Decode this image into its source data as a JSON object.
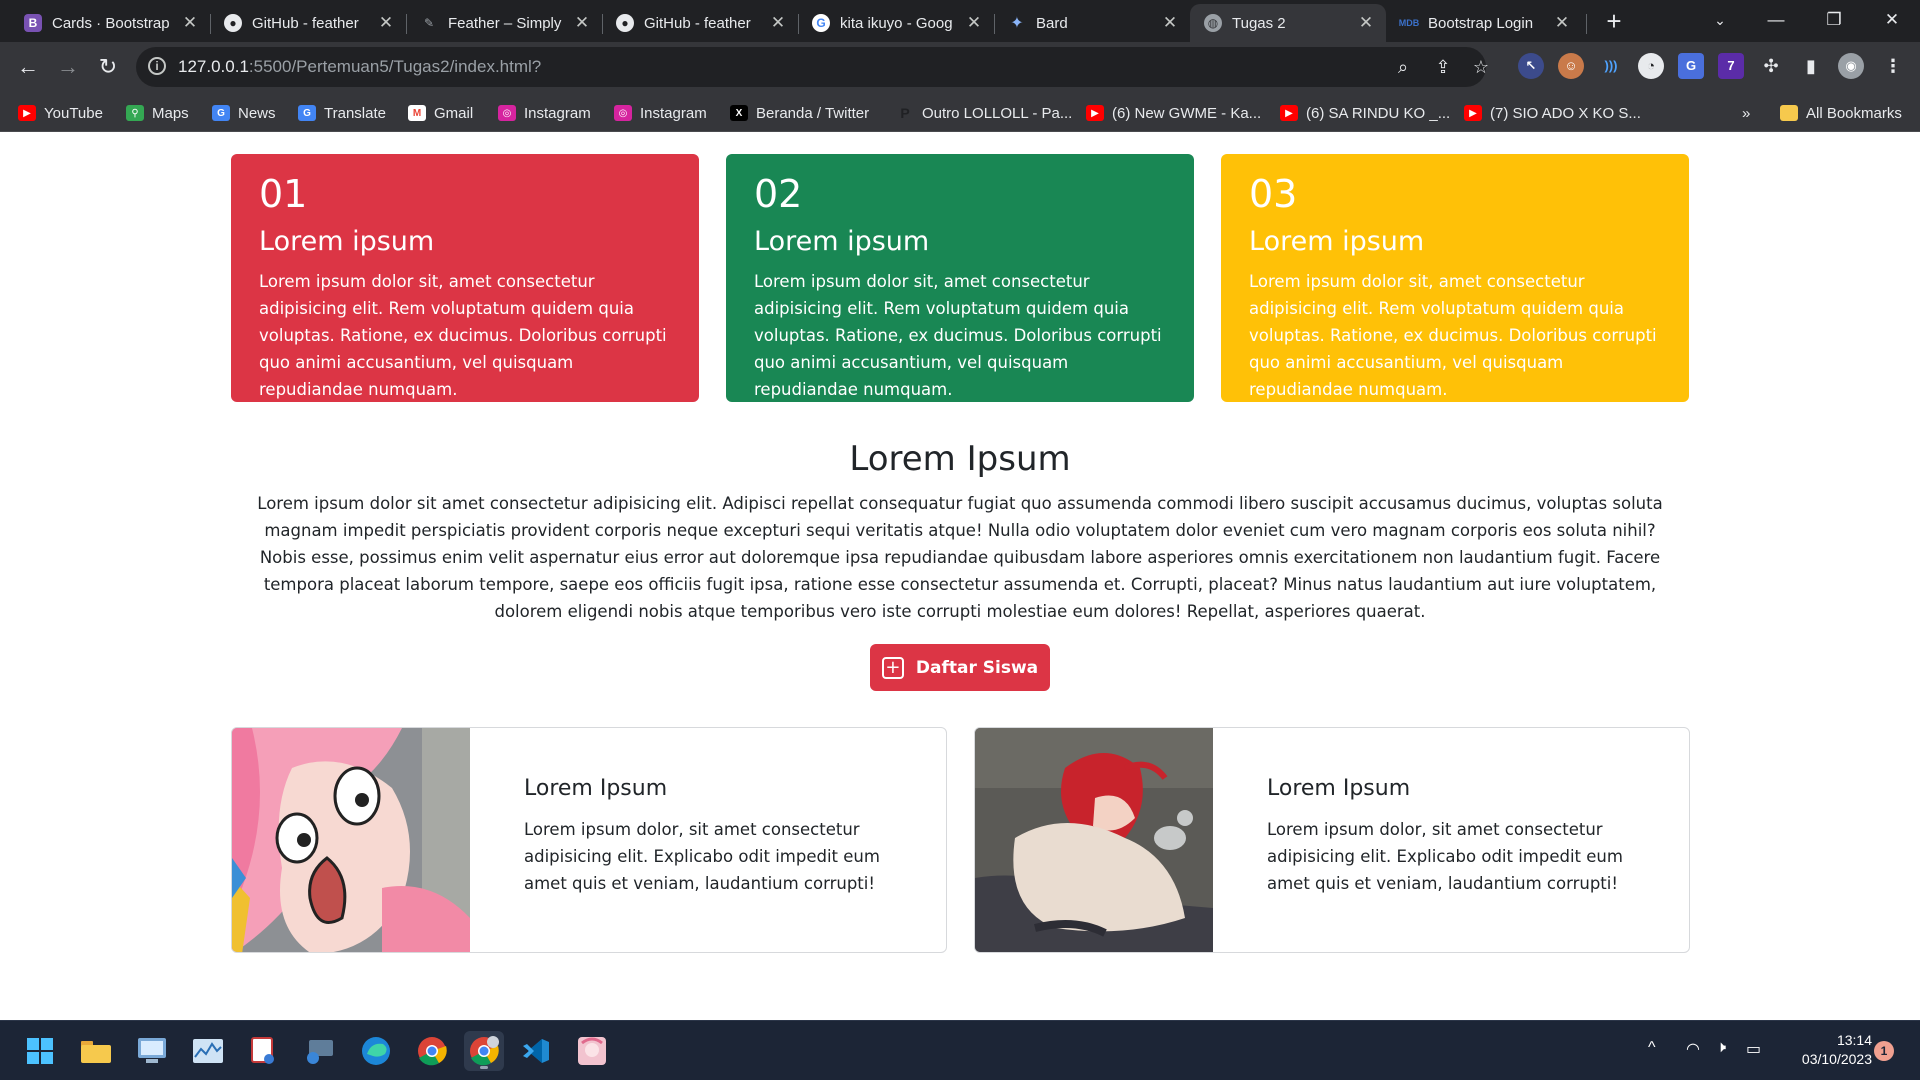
{
  "browser": {
    "tabs": [
      {
        "title": "Cards · Bootstrap",
        "favicon": "bootstrap-icon",
        "active": false
      },
      {
        "title": "GitHub - feather",
        "favicon": "github-icon",
        "active": false
      },
      {
        "title": "Feather – Simply",
        "favicon": "feather-icon",
        "active": false
      },
      {
        "title": "GitHub - feather",
        "favicon": "github-icon",
        "active": false
      },
      {
        "title": "kita ikuyo - Goog",
        "favicon": "google-icon",
        "active": false
      },
      {
        "title": "Bard",
        "favicon": "bard-icon",
        "active": false
      },
      {
        "title": "Tugas 2",
        "favicon": "globe-icon",
        "active": true
      },
      {
        "title": "Bootstrap Login",
        "favicon": "mdb-icon",
        "active": false
      }
    ],
    "address": {
      "host": "127.0.0.1",
      "path": ":5500/Pertemuan5/Tugas2/index.html?"
    },
    "bookmarks": [
      {
        "label": "YouTube",
        "icon": "youtube-icon"
      },
      {
        "label": "Maps",
        "icon": "maps-icon"
      },
      {
        "label": "News",
        "icon": "news-icon"
      },
      {
        "label": "Translate",
        "icon": "translate-icon"
      },
      {
        "label": "Gmail",
        "icon": "gmail-icon"
      },
      {
        "label": "Instagram",
        "icon": "instagram-icon"
      },
      {
        "label": "Instagram",
        "icon": "instagram-icon"
      },
      {
        "label": "Beranda / Twitter",
        "icon": "x-twitter-icon"
      },
      {
        "label": "Outro LOLLOLL - Pa...",
        "icon": "p-icon"
      },
      {
        "label": "(6) New GWME - Ka...",
        "icon": "youtube-icon"
      },
      {
        "label": "(6) SA RINDU KO _...",
        "icon": "youtube-icon"
      },
      {
        "label": "(7) SIO ADO X KO S...",
        "icon": "youtube-icon"
      }
    ],
    "all_bookmarks": "All Bookmarks",
    "more_bookmarks": "»"
  },
  "page": {
    "cards": [
      {
        "num": "01",
        "title": "Lorem ipsum",
        "text": "Lorem ipsum dolor sit, amet consectetur adipisicing elit. Rem voluptatum quidem quia voluptas. Ratione, ex ducimus. Doloribus corrupti quo animi accusantium, vel quisquam repudiandae numquam.",
        "color": "#dc3545"
      },
      {
        "num": "02",
        "title": "Lorem ipsum",
        "text": "Lorem ipsum dolor sit, amet consectetur adipisicing elit. Rem voluptatum quidem quia voluptas. Ratione, ex ducimus. Doloribus corrupti quo animi accusantium, vel quisquam repudiandae numquam.",
        "color": "#198754"
      },
      {
        "num": "03",
        "title": "Lorem ipsum",
        "text": "Lorem ipsum dolor sit, amet consectetur adipisicing elit. Rem voluptatum quidem quia voluptas. Ratione, ex ducimus. Doloribus corrupti quo animi accusantium, vel quisquam repudiandae numquam.",
        "color": "#ffc107"
      }
    ],
    "section_title": "Lorem Ipsum",
    "section_text": "Lorem ipsum dolor sit amet consectetur adipisicing elit. Adipisci repellat consequatur fugiat quo assumenda commodi libero suscipit accusamus ducimus, voluptas soluta magnam impedit perspiciatis provident corporis neque excepturi sequi veritatis atque! Nulla odio voluptatem dolor eveniet cum vero magnam corporis eos soluta nihil? Nobis esse, possimus enim velit aspernatur eius error aut doloremque ipsa repudiandae quibusdam labore asperiores omnis exercitationem non laudantium fugit. Facere tempora placeat laborum tempore, saepe eos officiis fugit ipsa, ratione esse consectetur assumenda et. Corrupti, placeat? Minus natus laudantium aut iure voluptatem, dolorem eligendi nobis atque temporibus vero iste corrupti molestiae eum dolores! Repellat, asperiores quaerat.",
    "cta_label": "Daftar Siswa",
    "cta_color": "#dc3545",
    "horizontal_cards": [
      {
        "title": "Lorem Ipsum",
        "text": "Lorem ipsum dolor, sit amet consectetur adipisicing elit. Explicabo odit impedit eum amet quis et veniam, laudantium corrupti!"
      },
      {
        "title": "Lorem Ipsum",
        "text": "Lorem ipsum dolor, sit amet consectetur adipisicing elit. Explicabo odit impedit eum amet quis et veniam, laudantium corrupti!"
      }
    ]
  },
  "taskbar": {
    "apps": [
      "windows-start-icon",
      "file-explorer-icon",
      "control-panel-icon",
      "resource-monitor-icon",
      "snipping-tool-icon",
      "remote-desktop-icon",
      "edge-icon",
      "chrome-icon",
      "chrome-profile-icon",
      "vscode-icon",
      "anime-app-icon"
    ],
    "time": "13:14",
    "date": "03/10/2023",
    "notifications": "1"
  }
}
